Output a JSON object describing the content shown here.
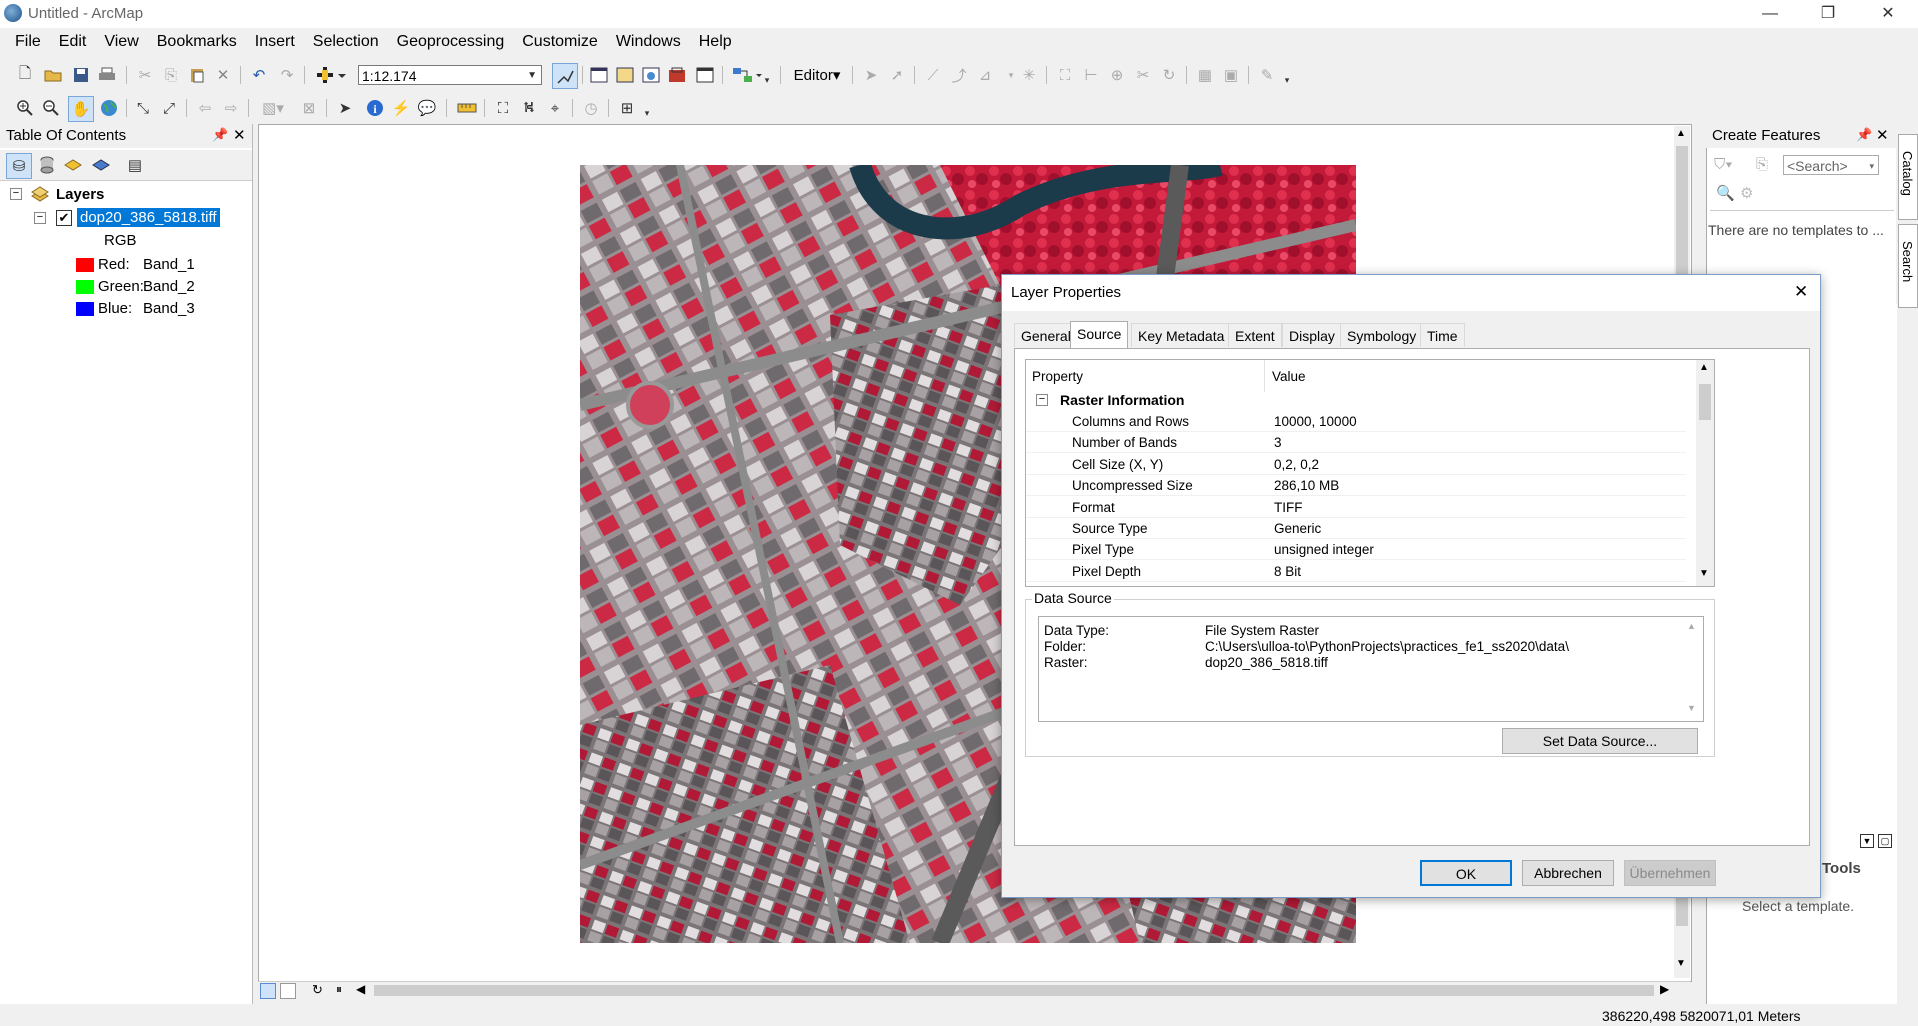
{
  "window": {
    "title": "Untitled - ArcMap",
    "minimize": "—",
    "restore": "❐",
    "close": "✕"
  },
  "menu": [
    "File",
    "Edit",
    "View",
    "Bookmarks",
    "Insert",
    "Selection",
    "Geoprocessing",
    "Customize",
    "Windows",
    "Help"
  ],
  "toolbar": {
    "scale": "1:12.174",
    "editor_label": "Editor▾"
  },
  "toc": {
    "title": "Table Of Contents",
    "root": "Layers",
    "layer_name": "dop20_386_5818.tiff",
    "layer_checked": true,
    "composite": "RGB",
    "bands": [
      {
        "label": "Red:",
        "value": "Band_1",
        "color": "#ff0000"
      },
      {
        "label": "Green:",
        "value": "Band_2",
        "color": "#00ff00"
      },
      {
        "label": "Blue:",
        "value": "Band_3",
        "color": "#0000ff"
      }
    ]
  },
  "create_features": {
    "title": "Create Features",
    "search_placeholder": "<Search>",
    "empty_message": "There are no templates to ...",
    "tools_label": "Tools",
    "select_hint": "Select a template."
  },
  "side_tabs": [
    "Catalog",
    "Search"
  ],
  "status": {
    "coordinates": "386220,498  5820071,01 Meters"
  },
  "dialog": {
    "title": "Layer Properties",
    "tabs": [
      "General",
      "Source",
      "Key Metadata",
      "Extent",
      "Display",
      "Symbology",
      "Time"
    ],
    "active_tab": "Source",
    "table": {
      "headers": [
        "Property",
        "Value"
      ],
      "section": "Raster Information",
      "rows": [
        {
          "property": "Columns and Rows",
          "value": "10000, 10000"
        },
        {
          "property": "Number of Bands",
          "value": "3"
        },
        {
          "property": "Cell Size (X, Y)",
          "value": "0,2, 0,2"
        },
        {
          "property": "Uncompressed Size",
          "value": "286,10 MB"
        },
        {
          "property": "Format",
          "value": "TIFF"
        },
        {
          "property": "Source Type",
          "value": "Generic"
        },
        {
          "property": "Pixel Type",
          "value": "unsigned integer"
        },
        {
          "property": "Pixel Depth",
          "value": "8 Bit"
        }
      ]
    },
    "data_source": {
      "legend": "Data Source",
      "rows": [
        {
          "label": "Data Type:",
          "value": "File System Raster"
        },
        {
          "label": "Folder:",
          "value": "C:\\Users\\ulloa-to\\PythonProjects\\practices_fe1_ss2020\\data\\"
        },
        {
          "label": "Raster:",
          "value": "dop20_386_5818.tiff"
        }
      ]
    },
    "set_source_button": "Set Data Source...",
    "ok_button": "OK",
    "cancel_button": "Abbrechen",
    "apply_button": "Übernehmen"
  }
}
